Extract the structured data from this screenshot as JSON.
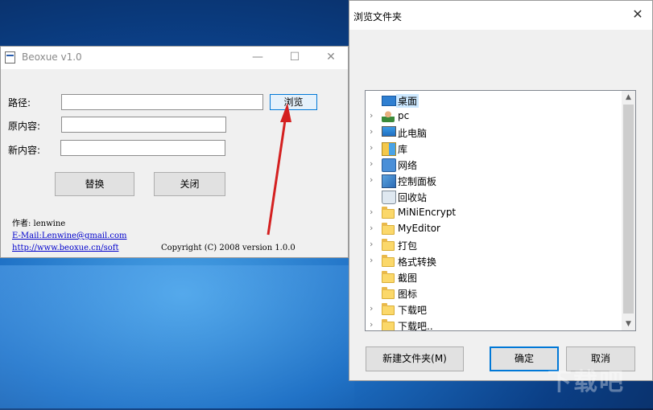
{
  "app_window": {
    "title": "Beoxue v1.0",
    "minimize": "—",
    "maximize": "☐",
    "close": "✕",
    "path_label": "路径:",
    "path_value": "",
    "browse_label": "浏览",
    "original_label": "原内容:",
    "original_value": "",
    "new_label": "新内容:",
    "new_value": "",
    "replace_label": "替换",
    "close_label": "关闭",
    "author": "作者: lenwine",
    "email": "E-Mail:Lenwine@gmail.com",
    "website": "http://www.beoxue.cn/soft",
    "copyright": "Copyright (C) 2008 version 1.0.0"
  },
  "folder_dialog": {
    "title": "浏览文件夹",
    "close": "✕",
    "items": [
      {
        "label": "桌面",
        "icon": "desktop-icon",
        "expandable": false,
        "selected": true
      },
      {
        "label": "pc",
        "icon": "user-icon",
        "expandable": true
      },
      {
        "label": "此电脑",
        "icon": "computer-icon",
        "expandable": true
      },
      {
        "label": "库",
        "icon": "library-icon",
        "expandable": true
      },
      {
        "label": "网络",
        "icon": "network-icon",
        "expandable": true
      },
      {
        "label": "控制面板",
        "icon": "control-panel-icon",
        "expandable": true
      },
      {
        "label": "回收站",
        "icon": "recycle-bin-icon",
        "expandable": false
      },
      {
        "label": "MiNiEncrypt",
        "icon": "folder-icon",
        "expandable": true
      },
      {
        "label": "MyEditor",
        "icon": "folder-icon",
        "expandable": true
      },
      {
        "label": "打包",
        "icon": "folder-icon",
        "expandable": true
      },
      {
        "label": "格式转换",
        "icon": "folder-icon",
        "expandable": true
      },
      {
        "label": "截图",
        "icon": "folder-icon",
        "expandable": false
      },
      {
        "label": "图标",
        "icon": "folder-icon",
        "expandable": false
      },
      {
        "label": "下载吧",
        "icon": "folder-icon",
        "expandable": true
      },
      {
        "label": "下载吧..",
        "icon": "folder-icon",
        "expandable": true
      }
    ],
    "new_folder_label": "新建文件夹(M)",
    "ok_label": "确定",
    "cancel_label": "取消"
  },
  "watermark": "下载吧",
  "colors": {
    "accent": "#0078d7",
    "arrow": "#d42020",
    "link": "#0000cc"
  }
}
